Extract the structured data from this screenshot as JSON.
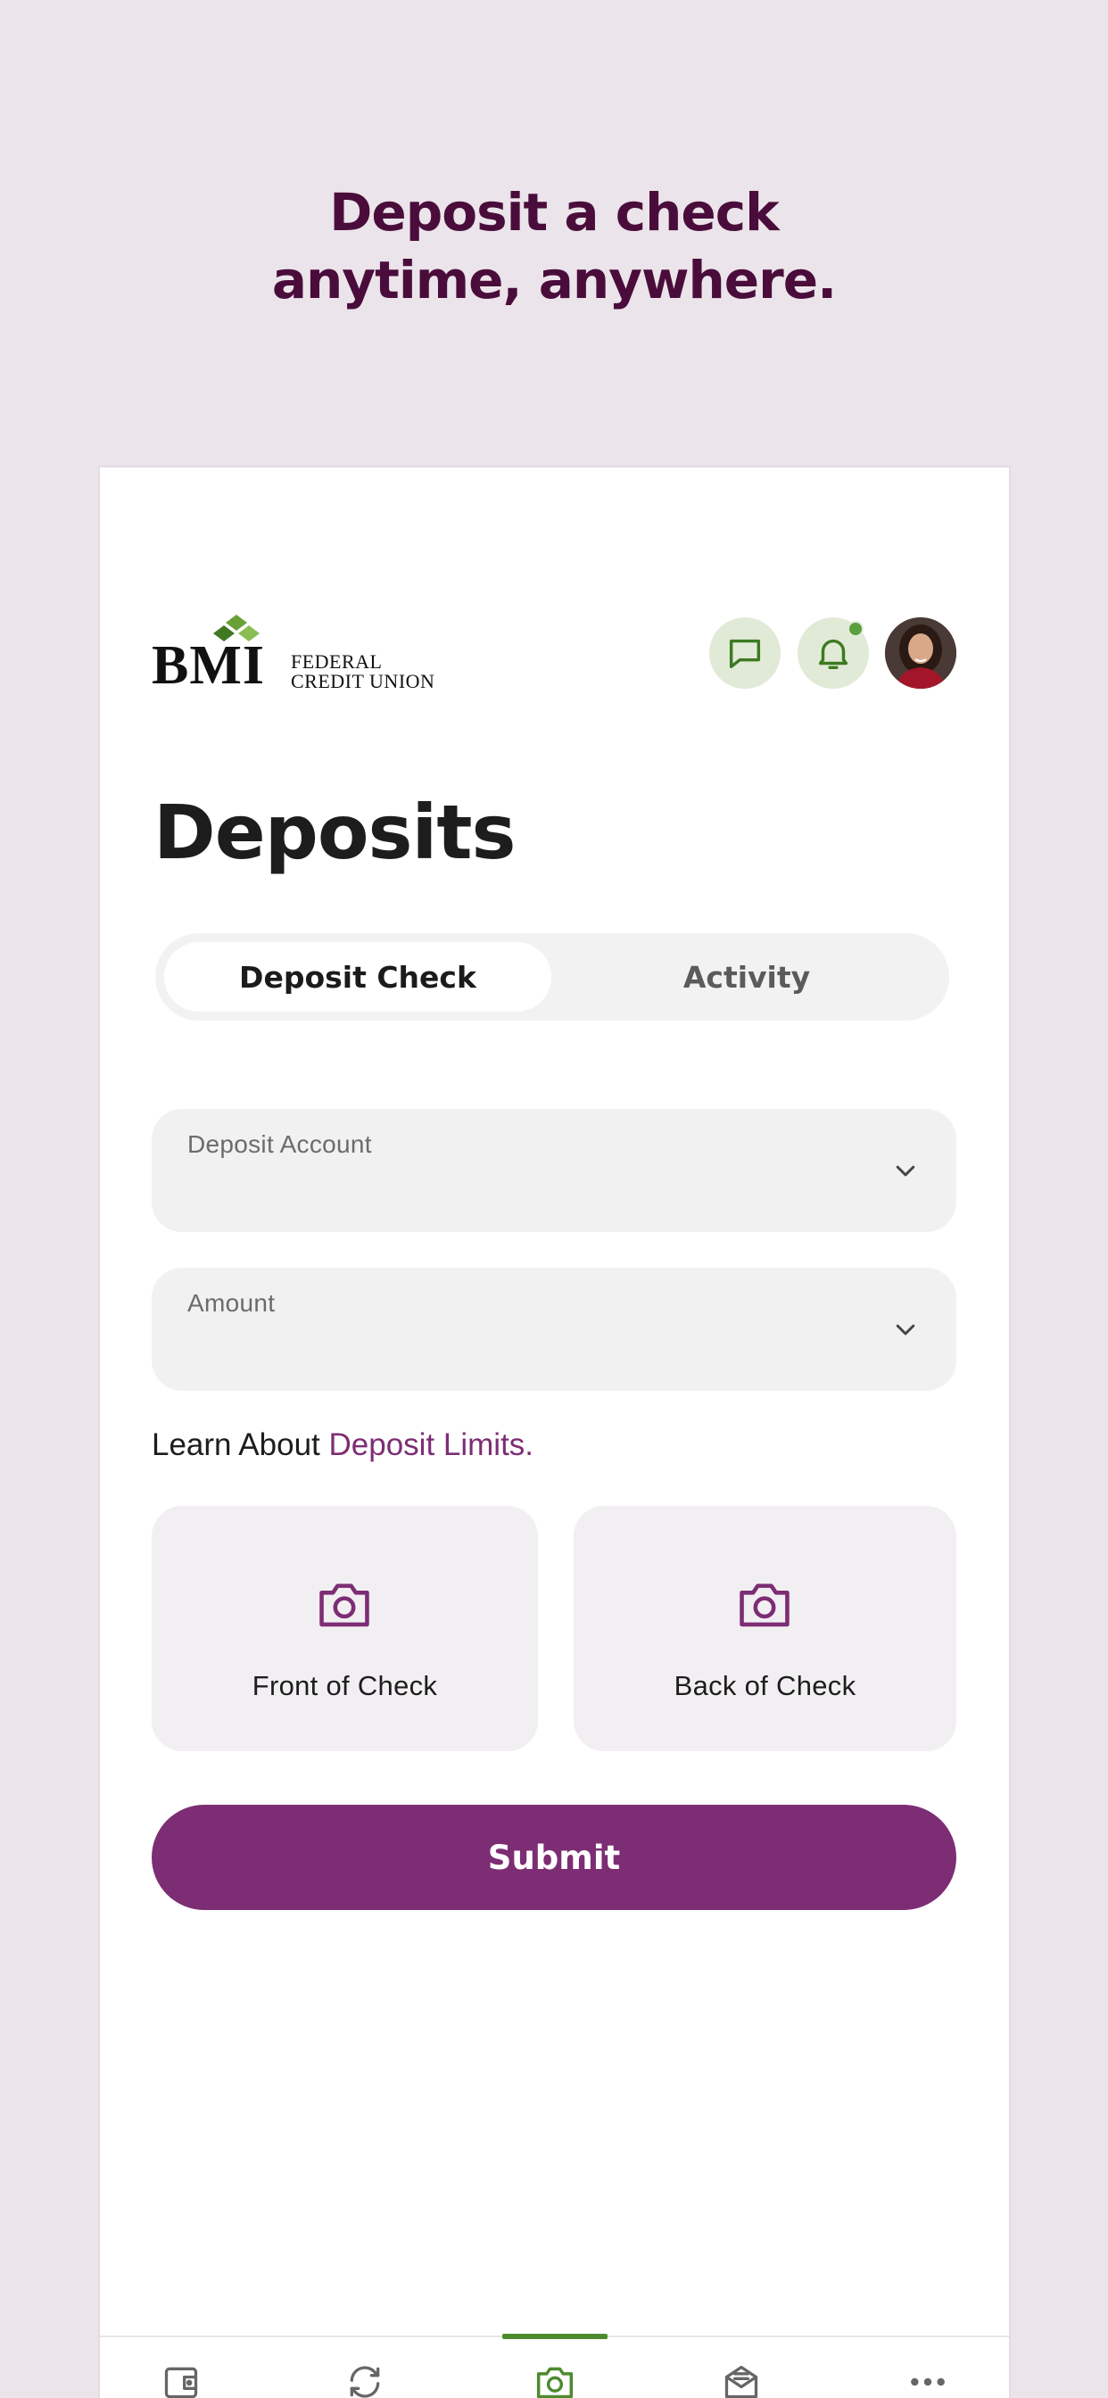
{
  "marketing": {
    "headline_line1": "Deposit a check",
    "headline_line2": "anytime, anywhere."
  },
  "header": {
    "logo_text": "BMI",
    "logo_sub_line1": "FEDERAL",
    "logo_sub_line2": "CREDIT UNION",
    "icons": [
      "chat-icon",
      "bell-icon",
      "avatar"
    ],
    "notification_dot": true
  },
  "page": {
    "title": "Deposits"
  },
  "tabs": {
    "items": [
      "Deposit Check",
      "Activity"
    ],
    "selected": "Deposit Check"
  },
  "form": {
    "deposit_account_label": "Deposit Account",
    "amount_label": "Amount",
    "learn_prefix": "Learn About ",
    "learn_link": "Deposit Limits."
  },
  "capture": {
    "front_label": "Front of Check",
    "back_label": "Back of Check"
  },
  "actions": {
    "submit_label": "Submit"
  },
  "tabbar": {
    "items": [
      "wallet-icon",
      "transfer-icon",
      "camera-icon",
      "statements-icon",
      "more-icon"
    ],
    "selected": "camera-icon"
  },
  "colors": {
    "background": "#ebe4ea",
    "headline": "#4a0d3b",
    "accent_purple": "#7d2d74",
    "accent_green": "#4d8a2e",
    "icon_bg": "#e1ead7"
  }
}
